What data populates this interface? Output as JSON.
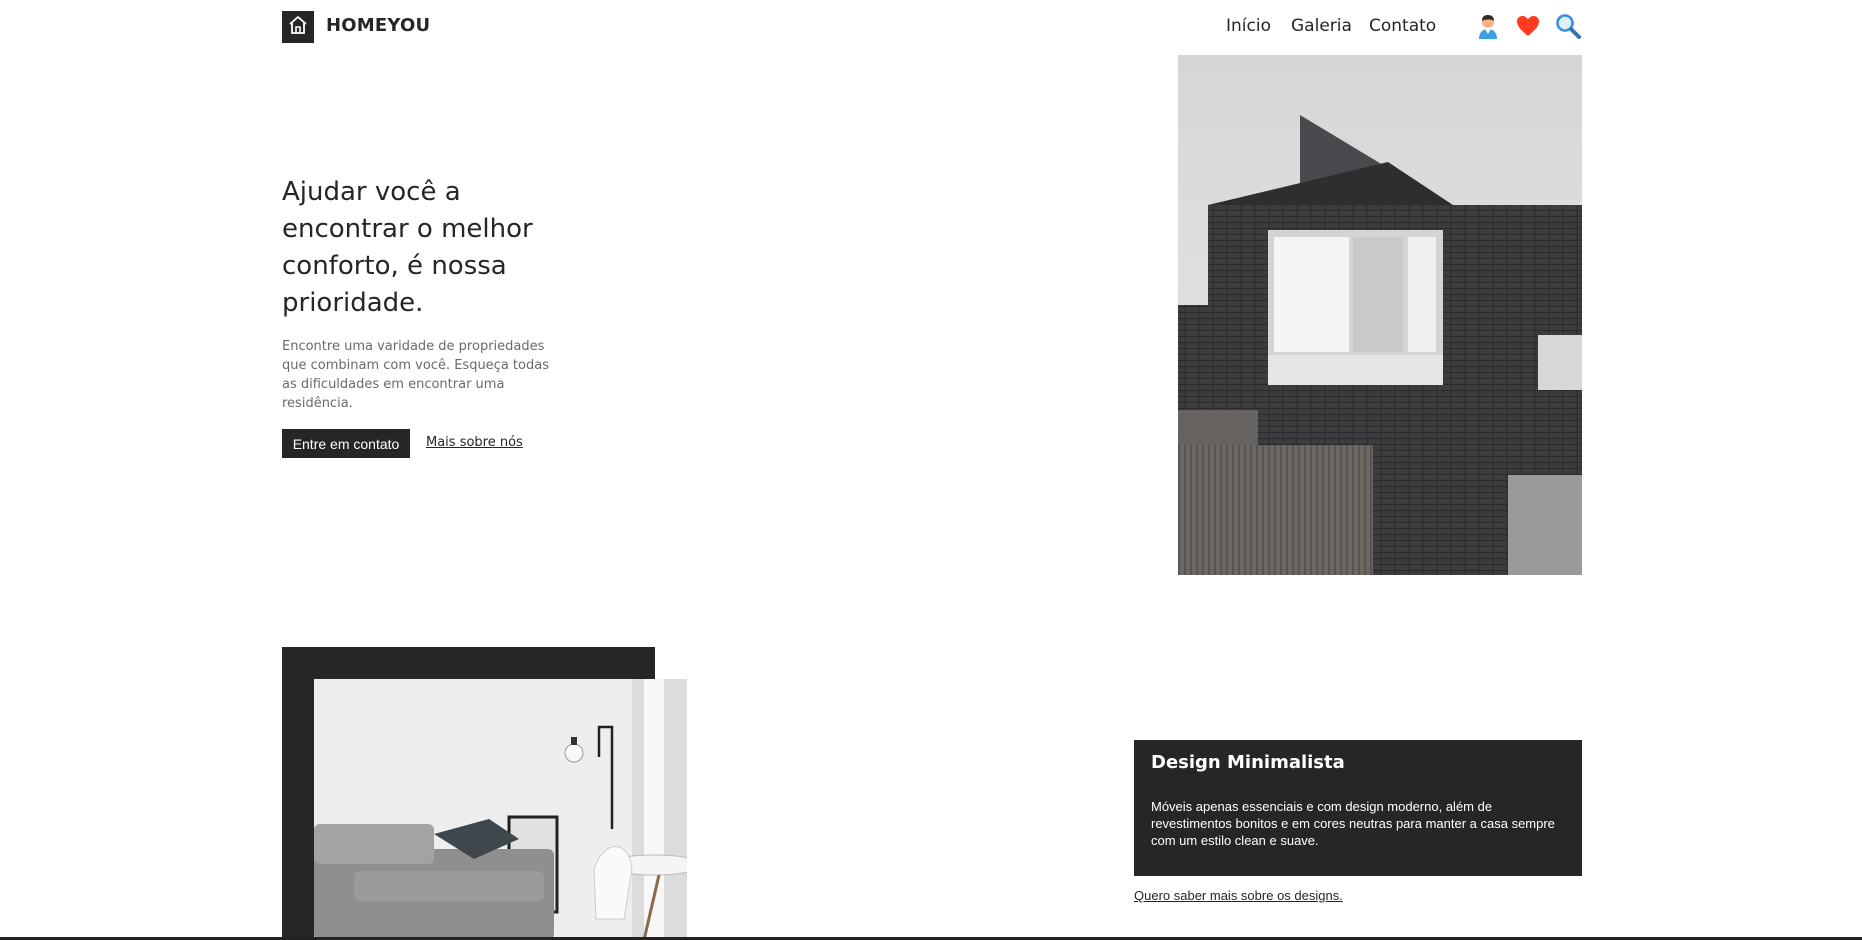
{
  "header": {
    "brand": "HOMEYOU",
    "nav": {
      "inicio": "Início",
      "galeria": "Galeria",
      "contato": "Contato"
    },
    "icons": [
      "home-icon",
      "user-icon",
      "heart-icon",
      "search-icon"
    ],
    "colors": {
      "heart": "#ff3b1f",
      "search": "#3a8ee6",
      "user": "#3aa0e0"
    }
  },
  "hero": {
    "title": "Ajudar você a encontrar o melhor conforto, é nossa prioridade.",
    "text": "Encontre uma varidade de propriedades que combinam com você. Esqueça todas as dificuldades em encontrar uma residência.",
    "button_label": "Entre em contato",
    "link_label": "Mais sobre nós"
  },
  "design": {
    "title": "Design Minimalista",
    "text": "Móveis apenas essenciais e com design moderno, além de revestimentos bonitos e em cores neutras para manter a casa sempre com um estilo clean e suave.",
    "link_label": "Quero saber mais sobre os designs."
  },
  "colors": {
    "dark": "#262626",
    "background": "#ffffff"
  }
}
